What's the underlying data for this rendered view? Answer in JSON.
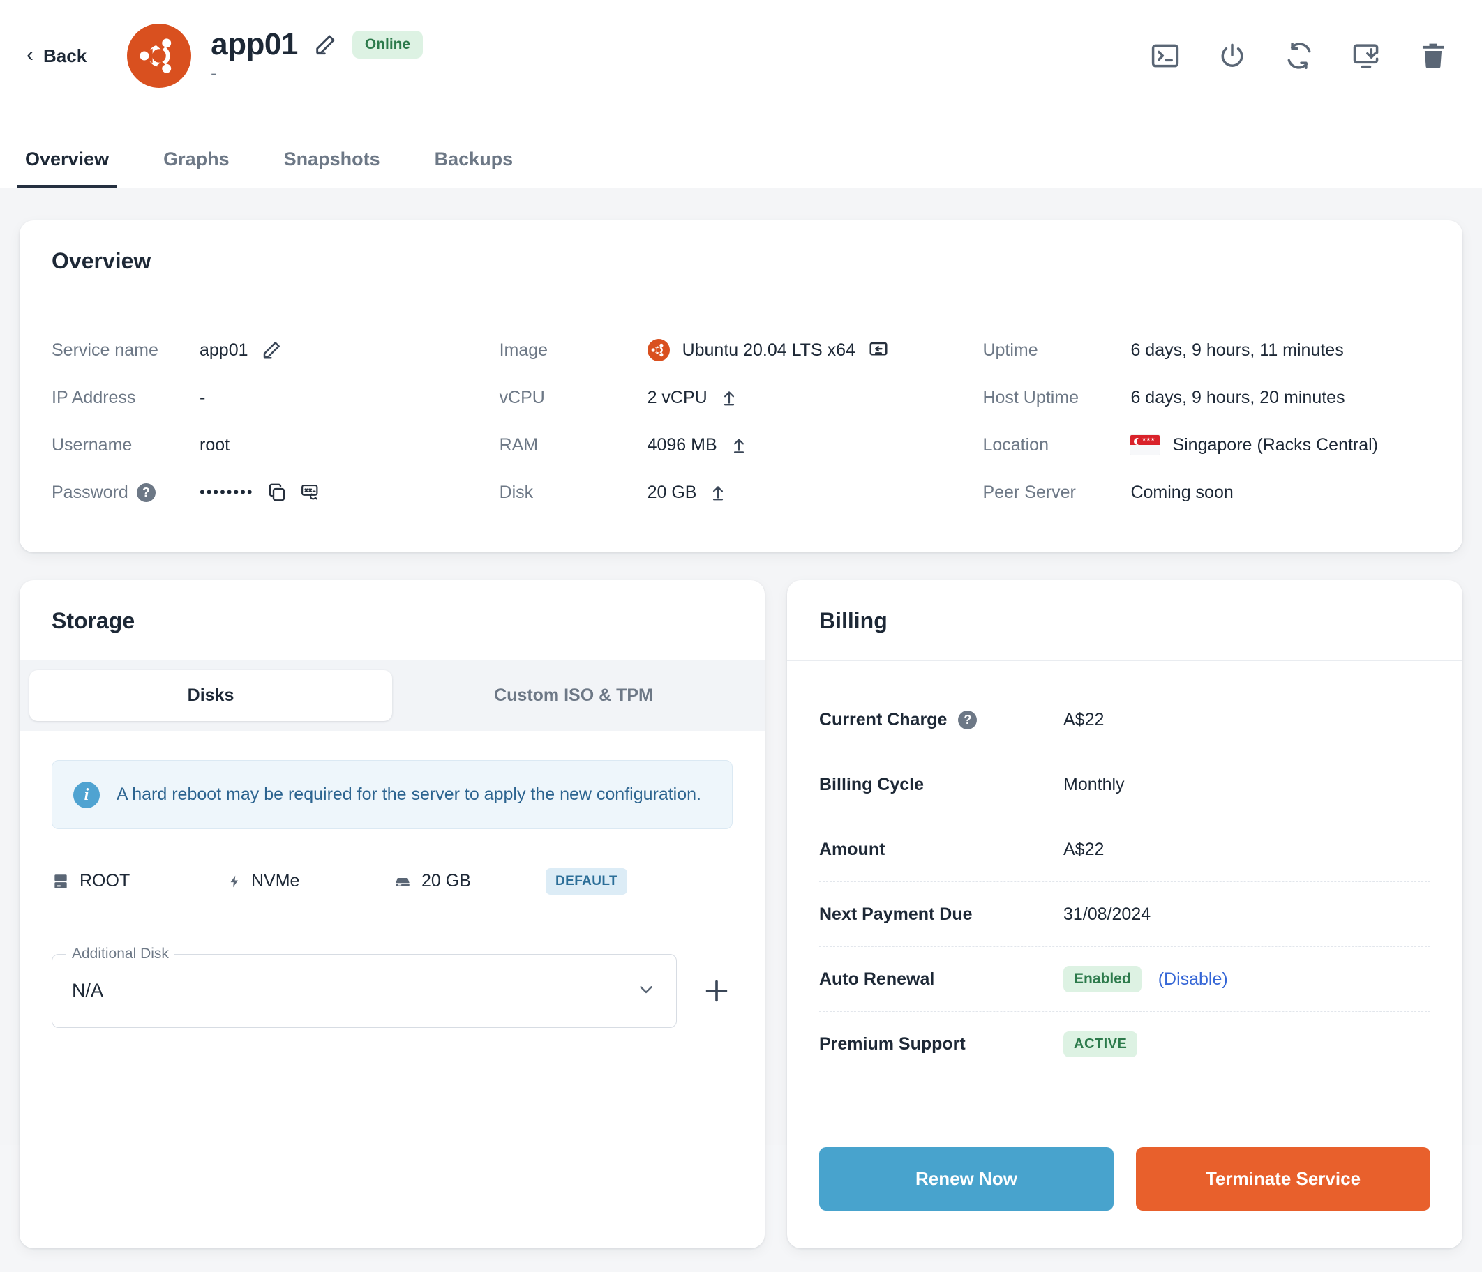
{
  "header": {
    "back_label": "Back",
    "server_name": "app01",
    "subtitle": "-",
    "status_badge": "Online",
    "actions": [
      {
        "name": "console-icon",
        "title": "Console"
      },
      {
        "name": "power-icon",
        "title": "Power"
      },
      {
        "name": "restart-icon",
        "title": "Restart"
      },
      {
        "name": "reinstall-icon",
        "title": "Reinstall"
      },
      {
        "name": "delete-icon",
        "title": "Delete"
      }
    ]
  },
  "tabs": [
    {
      "label": "Overview",
      "active": true
    },
    {
      "label": "Graphs",
      "active": false
    },
    {
      "label": "Snapshots",
      "active": false
    },
    {
      "label": "Backups",
      "active": false
    }
  ],
  "overview": {
    "title": "Overview",
    "col1": [
      {
        "label": "Service name",
        "value": "app01"
      },
      {
        "label": "IP Address",
        "value": "-"
      },
      {
        "label": "Username",
        "value": "root"
      },
      {
        "label": "Password",
        "value": "••••••••"
      }
    ],
    "col2": [
      {
        "label": "Image",
        "value": "Ubuntu 20.04 LTS x64"
      },
      {
        "label": "vCPU",
        "value": "2 vCPU"
      },
      {
        "label": "RAM",
        "value": "4096 MB"
      },
      {
        "label": "Disk",
        "value": "20 GB"
      }
    ],
    "col3": [
      {
        "label": "Uptime",
        "value": "6 days, 9 hours, 11 minutes"
      },
      {
        "label": "Host Uptime",
        "value": "6 days, 9 hours, 20 minutes"
      },
      {
        "label": "Location",
        "value": "Singapore (Racks Central)"
      },
      {
        "label": "Peer Server",
        "value": "Coming soon"
      }
    ]
  },
  "storage": {
    "title": "Storage",
    "tabs": [
      {
        "label": "Disks",
        "active": true
      },
      {
        "label": "Custom ISO & TPM",
        "active": false
      }
    ],
    "notice": "A hard reboot may be required for the server to apply the new configuration.",
    "disk": {
      "name": "ROOT",
      "type": "NVMe",
      "size": "20 GB",
      "tag": "DEFAULT"
    },
    "additional_disk": {
      "legend": "Additional Disk",
      "value": "N/A"
    }
  },
  "billing": {
    "title": "Billing",
    "rows": [
      {
        "label": "Current Charge",
        "value": "A$22",
        "help": true
      },
      {
        "label": "Billing Cycle",
        "value": "Monthly"
      },
      {
        "label": "Amount",
        "value": "A$22"
      },
      {
        "label": "Next Payment Due",
        "value": "31/08/2024"
      },
      {
        "label": "Auto Renewal",
        "chip": "Enabled",
        "link": "(Disable)"
      },
      {
        "label": "Premium Support",
        "chip": "ACTIVE"
      }
    ],
    "renew_label": "Renew Now",
    "terminate_label": "Terminate Service"
  },
  "colors": {
    "accent_orange": "#d9501f",
    "primary_blue": "#48a3cd",
    "danger": "#e8602c",
    "green_text": "#2c7a4b",
    "green_bg": "#ddf2e3",
    "link": "#3566d6",
    "muted": "#6d7886"
  }
}
